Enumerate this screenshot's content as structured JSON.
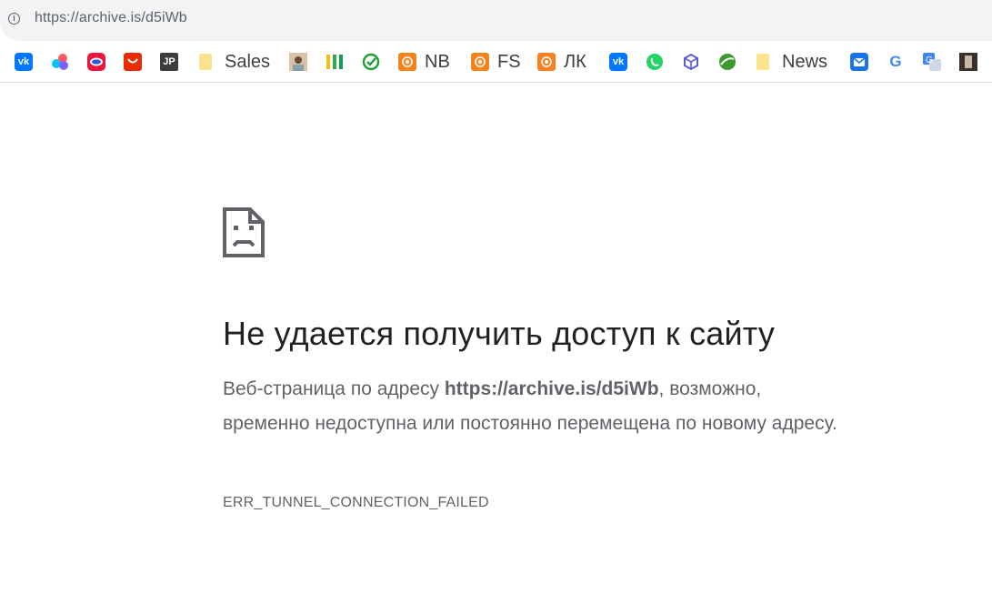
{
  "omnibox": {
    "url": "https://archive.is/d5iWb",
    "info_icon": "info-icon"
  },
  "bookmarks": {
    "items": [
      {
        "name": "vk-icon",
        "label": "",
        "color": "#0077ff"
      },
      {
        "name": "colorful-dots-icon",
        "label": "",
        "color": "#7b61ff"
      },
      {
        "name": "circle-logo-icon",
        "label": "",
        "color": "#e8173f"
      },
      {
        "name": "aliexpress-icon",
        "label": "",
        "color": "#e62e04"
      },
      {
        "name": "jp-icon",
        "label": "",
        "glyph": "JP",
        "color": "#3c3c3c"
      },
      {
        "name": "folder-icon",
        "label": "Sales",
        "color": "#fbe38e"
      },
      {
        "name": "photo-avatar-icon",
        "label": "",
        "color": "#b08a6a"
      },
      {
        "name": "bars-icon",
        "label": "",
        "color": "#f4c20d"
      },
      {
        "name": "sber-icon",
        "label": "",
        "color": "#21a038"
      },
      {
        "name": "orange-flower-icon",
        "label": "NB",
        "color": "#f58220"
      },
      {
        "name": "orange-flower-icon",
        "label": "FS",
        "color": "#f58220"
      },
      {
        "name": "orange-flower-icon",
        "label": "ЛК",
        "color": "#f58220"
      },
      {
        "name": "vk-icon",
        "label": "",
        "color": "#0077ff"
      },
      {
        "name": "whatsapp-icon",
        "label": "",
        "color": "#25d366"
      },
      {
        "name": "box-icon",
        "label": "",
        "color": "#5b5bd6"
      },
      {
        "name": "green-ball-icon",
        "label": "",
        "color": "#3c9a2f"
      },
      {
        "name": "folder-icon",
        "label": "News",
        "color": "#fbe38e"
      },
      {
        "name": "mail-icon",
        "label": "",
        "color": "#1a73e8"
      },
      {
        "name": "google-icon",
        "label": "",
        "glyph": "G",
        "color": "#4285f4"
      },
      {
        "name": "translate-icon",
        "label": "",
        "color": "#4285f4"
      },
      {
        "name": "photo-thumbnail-icon",
        "label": "",
        "color": "#3b2f2a"
      }
    ]
  },
  "error": {
    "icon": "sad-document-icon",
    "title": "Не удается получить доступ к сайту",
    "desc_prefix": "Веб-страница по адресу ",
    "desc_url": "https://archive.is/d5iWb",
    "desc_suffix": ", возможно, временно недоступна или постоянно перемещена по новому адресу.",
    "code": "ERR_TUNNEL_CONNECTION_FAILED"
  }
}
